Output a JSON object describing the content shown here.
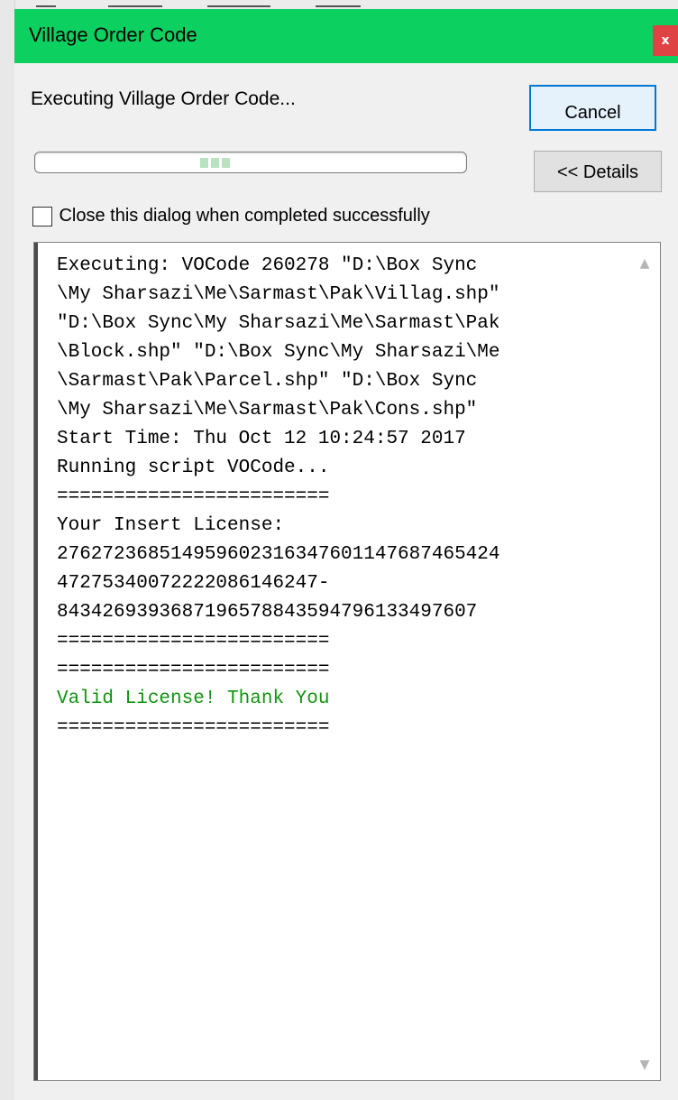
{
  "window": {
    "title": "Village Order Code",
    "title_bar_color": "#0cd160",
    "close_glyph": "x"
  },
  "status": {
    "text": "Executing Village Order Code...",
    "progress_state": "indeterminate"
  },
  "buttons": {
    "cancel_label": "Cancel",
    "details_label": "<< Details"
  },
  "checkbox": {
    "label": "Close this dialog when completed successfully",
    "checked": false
  },
  "log": {
    "lines": [
      {
        "text": "Executing: VOCode 260278 \"D:\\Box Sync",
        "type": "normal"
      },
      {
        "text": "\\My Sharsazi\\Me\\Sarmast\\Pak\\Villag.shp\"",
        "type": "normal"
      },
      {
        "text": "\"D:\\Box Sync\\My Sharsazi\\Me\\Sarmast\\Pak",
        "type": "normal"
      },
      {
        "text": "\\Block.shp\" \"D:\\Box Sync\\My Sharsazi\\Me",
        "type": "normal"
      },
      {
        "text": "\\Sarmast\\Pak\\Parcel.shp\" \"D:\\Box Sync",
        "type": "normal"
      },
      {
        "text": "\\My Sharsazi\\Me\\Sarmast\\Pak\\Cons.shp\"",
        "type": "normal"
      },
      {
        "text": "Start Time: Thu Oct 12 10:24:57 2017",
        "type": "normal"
      },
      {
        "text": "Running script VOCode...",
        "type": "normal"
      },
      {
        "text": "========================",
        "type": "normal"
      },
      {
        "text": "Your Insert License:",
        "type": "normal"
      },
      {
        "text": "27627236851495960231634760114768746542​4",
        "type": "normal"
      },
      {
        "text": "4727534007222208614624​7-",
        "type": "normal"
      },
      {
        "text": "84342693936871965788435947961334976​07",
        "type": "normal"
      },
      {
        "text": "========================",
        "type": "normal"
      },
      {
        "text": "========================",
        "type": "normal"
      },
      {
        "text": "Valid License! Thank You",
        "type": "success"
      },
      {
        "text": "========================",
        "type": "normal"
      }
    ],
    "success_color": "#109410"
  },
  "icons": {
    "scroll_up": "chevron-up-icon",
    "scroll_down": "chevron-down-icon"
  }
}
